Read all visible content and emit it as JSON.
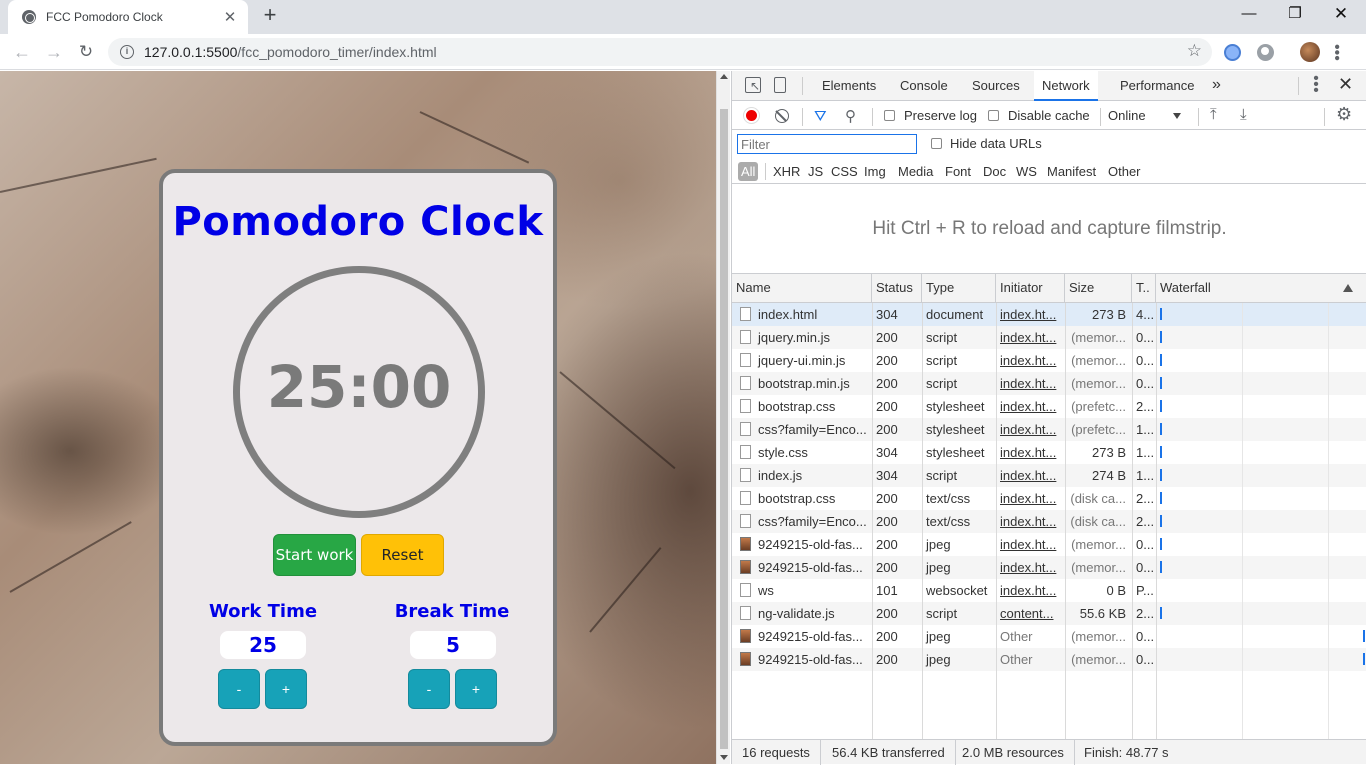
{
  "browser": {
    "tab_title": "FCC Pomodoro Clock",
    "tab_close": "✕",
    "new_tab": "+",
    "window_min": "—",
    "window_max": "❐",
    "window_close": "✕",
    "back": "←",
    "forward": "→",
    "reload": "↻",
    "url_host": "127.0.0.1:5500",
    "url_path": "/fcc_pomodoro_timer/index.html",
    "star": "☆"
  },
  "app": {
    "title": "Pomodoro Clock",
    "time": "25:00",
    "start_label": "Start work",
    "reset_label": "Reset",
    "work": {
      "label": "Work Time",
      "value": "25",
      "minus": "-",
      "plus": "+"
    },
    "break": {
      "label": "Break Time",
      "value": "5",
      "minus": "-",
      "plus": "+"
    }
  },
  "devtools": {
    "tabs": [
      "Elements",
      "Console",
      "Sources",
      "Network",
      "Performance"
    ],
    "active_tab": "Network",
    "more": "»",
    "close": "✕",
    "preserve_log": "Preserve log",
    "disable_cache": "Disable cache",
    "throttle": "Online",
    "filter_placeholder": "Filter",
    "hide_data_urls": "Hide data URLs",
    "types": [
      "All",
      "XHR",
      "JS",
      "CSS",
      "Img",
      "Media",
      "Font",
      "Doc",
      "WS",
      "Manifest",
      "Other"
    ],
    "filmstrip_hint": "Hit Ctrl + R to reload and capture filmstrip.",
    "columns": [
      "Name",
      "Status",
      "Type",
      "Initiator",
      "Size",
      "T..",
      "Waterfall"
    ],
    "requests": [
      {
        "name": "index.html",
        "status": "304",
        "type": "document",
        "initiator": "index.ht...",
        "size": "273 B",
        "time": "4...",
        "icon": "doc"
      },
      {
        "name": "jquery.min.js",
        "status": "200",
        "type": "script",
        "initiator": "index.ht...",
        "size": "(memor...",
        "time": "0...",
        "icon": "doc"
      },
      {
        "name": "jquery-ui.min.js",
        "status": "200",
        "type": "script",
        "initiator": "index.ht...",
        "size": "(memor...",
        "time": "0...",
        "icon": "doc"
      },
      {
        "name": "bootstrap.min.js",
        "status": "200",
        "type": "script",
        "initiator": "index.ht...",
        "size": "(memor...",
        "time": "0...",
        "icon": "doc"
      },
      {
        "name": "bootstrap.css",
        "status": "200",
        "type": "stylesheet",
        "initiator": "index.ht...",
        "size": "(prefetc...",
        "time": "2...",
        "icon": "doc"
      },
      {
        "name": "css?family=Enco...",
        "status": "200",
        "type": "stylesheet",
        "initiator": "index.ht...",
        "size": "(prefetc...",
        "time": "1...",
        "icon": "doc"
      },
      {
        "name": "style.css",
        "status": "304",
        "type": "stylesheet",
        "initiator": "index.ht...",
        "size": "273 B",
        "time": "1...",
        "icon": "doc"
      },
      {
        "name": "index.js",
        "status": "304",
        "type": "script",
        "initiator": "index.ht...",
        "size": "274 B",
        "time": "1...",
        "icon": "doc"
      },
      {
        "name": "bootstrap.css",
        "status": "200",
        "type": "text/css",
        "initiator": "index.ht...",
        "size": "(disk ca...",
        "time": "2...",
        "icon": "doc"
      },
      {
        "name": "css?family=Enco...",
        "status": "200",
        "type": "text/css",
        "initiator": "index.ht...",
        "size": "(disk ca...",
        "time": "2...",
        "icon": "doc"
      },
      {
        "name": "9249215-old-fas...",
        "status": "200",
        "type": "jpeg",
        "initiator": "index.ht...",
        "size": "(memor...",
        "time": "0...",
        "icon": "img"
      },
      {
        "name": "9249215-old-fas...",
        "status": "200",
        "type": "jpeg",
        "initiator": "index.ht...",
        "size": "(memor...",
        "time": "0...",
        "icon": "img"
      },
      {
        "name": "ws",
        "status": "101",
        "type": "websocket",
        "initiator": "index.ht...",
        "size": "0 B",
        "time": "P...",
        "icon": "doc"
      },
      {
        "name": "ng-validate.js",
        "status": "200",
        "type": "script",
        "initiator": "content...",
        "size": "55.6 KB",
        "time": "2...",
        "icon": "doc"
      },
      {
        "name": "9249215-old-fas...",
        "status": "200",
        "type": "jpeg",
        "initiator": "Other",
        "size": "(memor...",
        "time": "0...",
        "icon": "img"
      },
      {
        "name": "9249215-old-fas...",
        "status": "200",
        "type": "jpeg",
        "initiator": "Other",
        "size": "(memor...",
        "time": "0...",
        "icon": "img"
      }
    ],
    "summary": {
      "requests": "16 requests",
      "transferred": "56.4 KB transferred",
      "resources": "2.0 MB resources",
      "finish": "Finish: 48.77 s"
    }
  }
}
